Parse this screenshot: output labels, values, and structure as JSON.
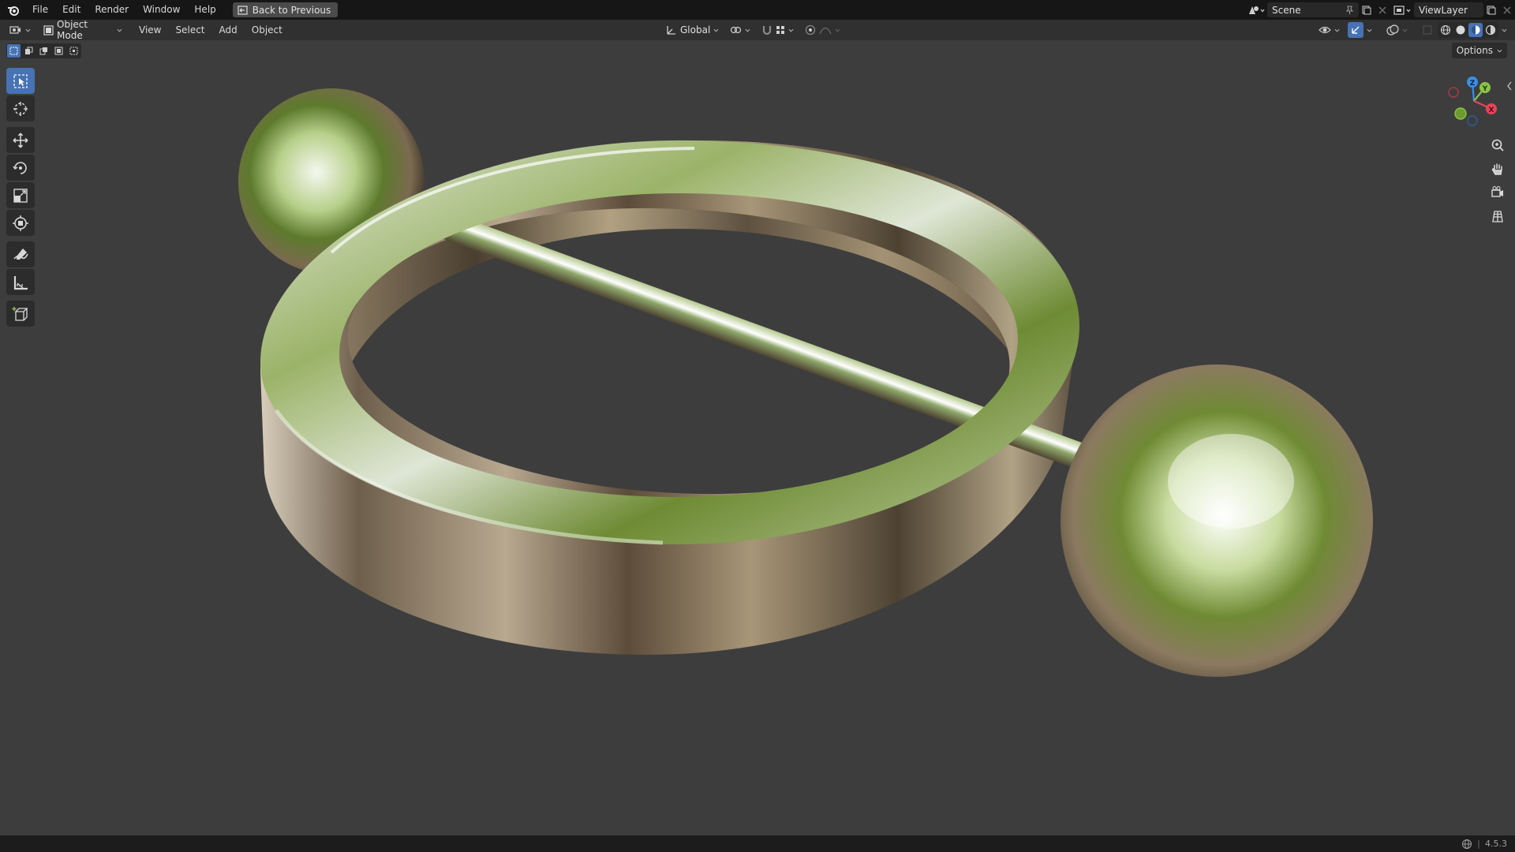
{
  "menu": {
    "items": [
      "File",
      "Edit",
      "Render",
      "Window",
      "Help"
    ],
    "back_label": "Back to Previous"
  },
  "topright": {
    "scene_label": "Scene",
    "viewlayer_label": "ViewLayer"
  },
  "viewheader": {
    "mode_label": "Object Mode",
    "menus": [
      "View",
      "Select",
      "Add",
      "Object"
    ],
    "orientation_label": "Global"
  },
  "viewport": {
    "options_label": "Options"
  },
  "gizmo": {
    "x_label": "X",
    "y_label": "Y",
    "z_label": "Z"
  },
  "status": {
    "version": "4.5.3"
  },
  "colors": {
    "accent": "#4772b3",
    "axis_x": "#e8435a",
    "axis_y": "#8bc34a",
    "axis_z": "#3a8fe8"
  },
  "icons": [
    "blender-logo-icon",
    "editor-type-icon",
    "object-mode-icon",
    "transform-orientation-icon",
    "pivot-icon",
    "snap-icon",
    "proportional-edit-icon",
    "visibility-icon",
    "gizmo-icon",
    "overlay-icon",
    "xray-icon",
    "wireframe-shading-icon",
    "solid-shading-icon",
    "material-shading-icon",
    "rendered-shading-icon",
    "select-box-icon",
    "cursor-icon",
    "move-icon",
    "rotate-icon",
    "scale-icon",
    "transform-icon",
    "annotate-icon",
    "measure-icon",
    "add-cube-icon",
    "zoom-icon",
    "hand-pan-icon",
    "camera-icon",
    "grid-view-icon",
    "globe-icon"
  ]
}
